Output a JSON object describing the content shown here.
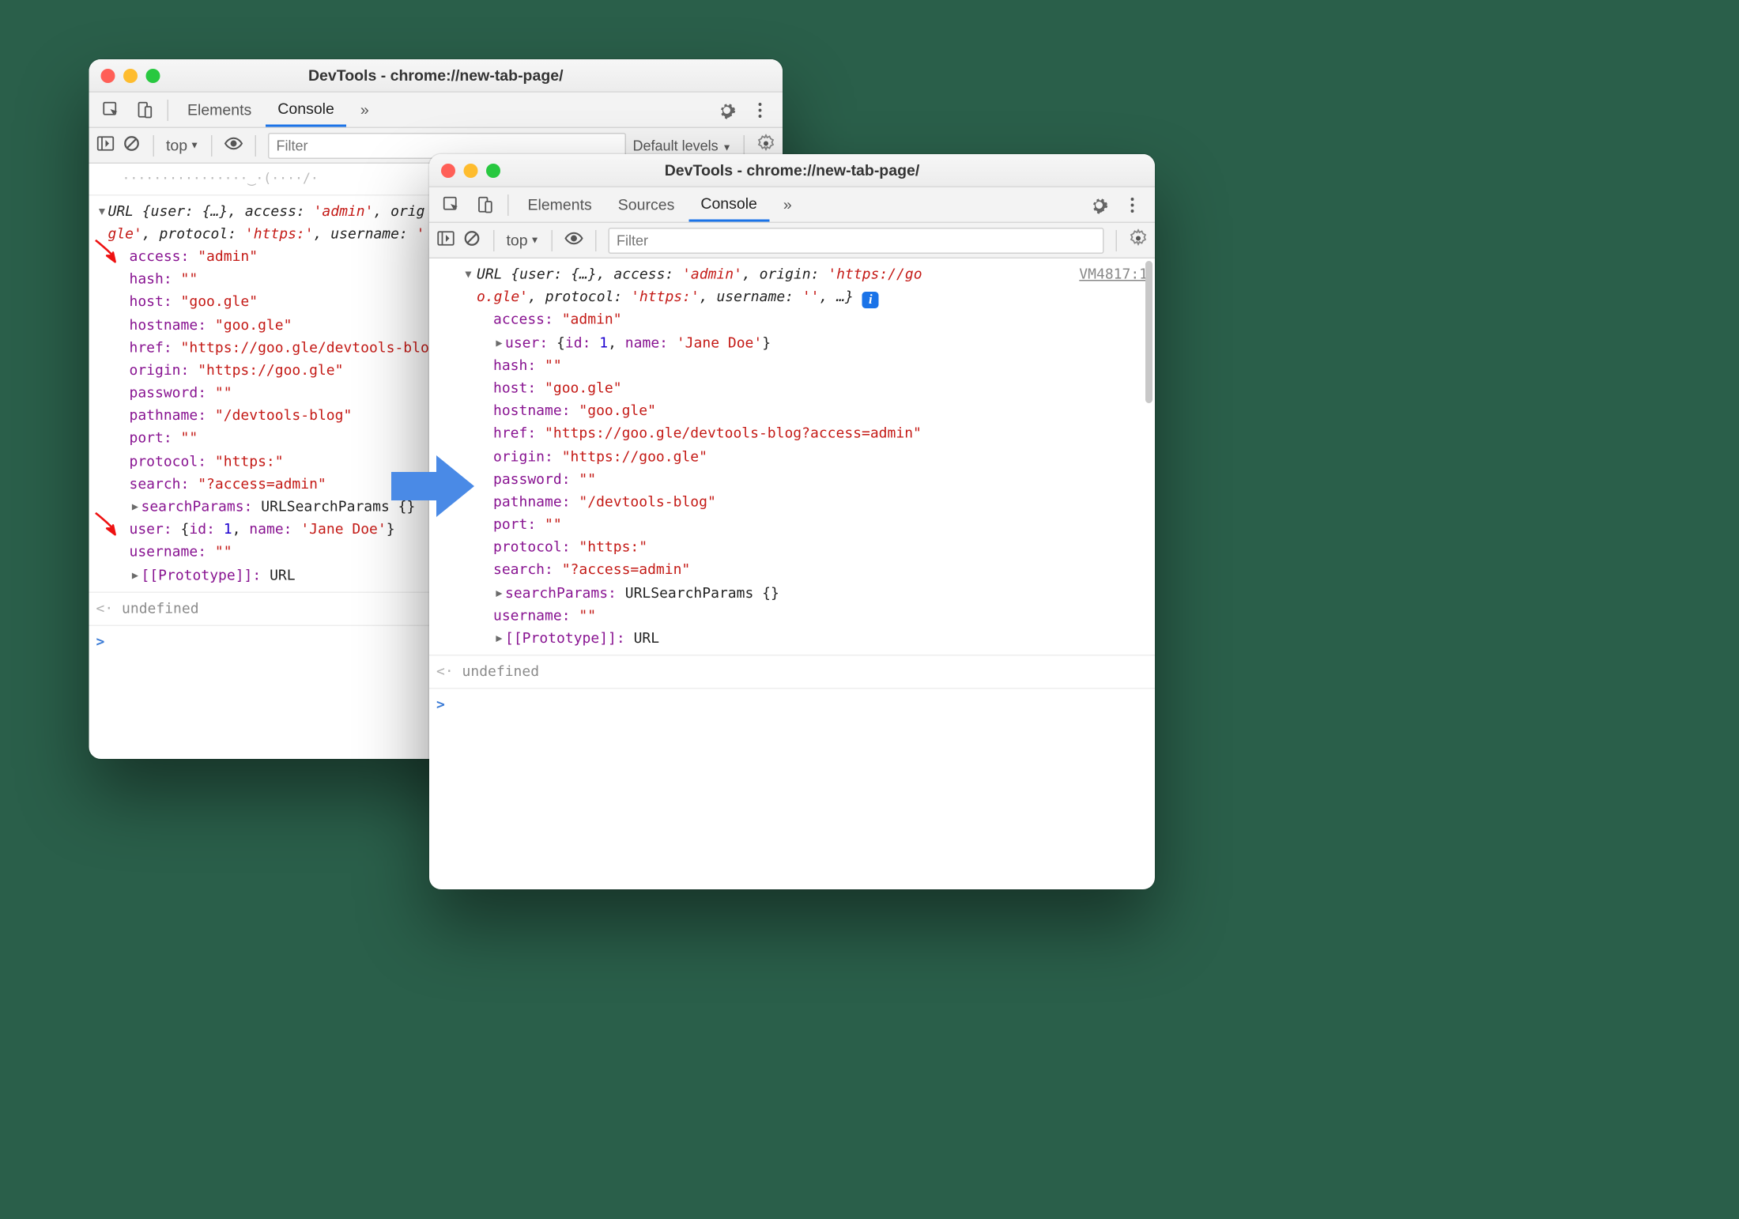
{
  "titleLeft": "DevTools - chrome://new-tab-page/",
  "titleRight": "DevTools - chrome://new-tab-page/",
  "tabsLeft": {
    "elements": "Elements",
    "console": "Console",
    "more": "»"
  },
  "tabsRight": {
    "elements": "Elements",
    "sources": "Sources",
    "console": "Console",
    "more": "»"
  },
  "ctx": "top",
  "filterPlaceholder": "Filter",
  "levels": "Default levels",
  "sourceLink": "VM4817:1",
  "undef": "undefined",
  "summaryL1a": "URL {user: {…}, access: ",
  "summaryL1b": ", orig",
  "summaryL2": "gle'",
  "summaryL2b": ", protocol: ",
  "summaryL2c": ", username: ",
  "sp_admin": "'admin'",
  "sp_https": "'https:'",
  "sp_emptyq": "'",
  "summaryR1a": "URL {user: {…}, access: ",
  "summaryR1b": ", origin: ",
  "summaryR1c": "'https://go",
  "summaryR2a": "o.gle'",
  "summaryR2b": ", protocol: ",
  "summaryR2c": ", username: ",
  "summaryR2d": "''",
  "summaryR2e": ", …}",
  "left": {
    "access_k": "access:",
    "access_v": "\"admin\"",
    "hash_k": "hash:",
    "hash_v": "\"\"",
    "host_k": "host:",
    "host_v": "\"goo.gle\"",
    "hostname_k": "hostname:",
    "hostname_v": "\"goo.gle\"",
    "href_k": "href:",
    "href_v": "\"https://goo.gle/devtools-blo",
    "origin_k": "origin:",
    "origin_v": "\"https://goo.gle\"",
    "password_k": "password:",
    "password_v": "\"\"",
    "pathname_k": "pathname:",
    "pathname_v": "\"/devtools-blog\"",
    "port_k": "port:",
    "port_v": "\"\"",
    "protocol_k": "protocol:",
    "protocol_v": "\"https:\"",
    "search_k": "search:",
    "search_v": "\"?access=admin\"",
    "sp_k": "searchParams:",
    "sp_v": "URLSearchParams {}",
    "user_k": "user:",
    "user_pre": "{",
    "user_idk": "id:",
    "user_idv": "1",
    "user_c": ", ",
    "user_nk": "name:",
    "user_nv": "'Jane Doe'",
    "user_post": "}",
    "username_k": "username:",
    "username_v": "\"\"",
    "proto_k": "[[Prototype]]:",
    "proto_v": "URL"
  },
  "right": {
    "access_k": "access:",
    "access_v": "\"admin\"",
    "user_k": "user:",
    "user_pre": "{",
    "user_idk": "id:",
    "user_idv": "1",
    "user_c": ", ",
    "user_nk": "name:",
    "user_nv": "'Jane Doe'",
    "user_post": "}",
    "hash_k": "hash:",
    "hash_v": "\"\"",
    "host_k": "host:",
    "host_v": "\"goo.gle\"",
    "hostname_k": "hostname:",
    "hostname_v": "\"goo.gle\"",
    "href_k": "href:",
    "href_v": "\"https://goo.gle/devtools-blog?access=admin\"",
    "origin_k": "origin:",
    "origin_v": "\"https://goo.gle\"",
    "password_k": "password:",
    "password_v": "\"\"",
    "pathname_k": "pathname:",
    "pathname_v": "\"/devtools-blog\"",
    "port_k": "port:",
    "port_v": "\"\"",
    "protocol_k": "protocol:",
    "protocol_v": "\"https:\"",
    "search_k": "search:",
    "search_v": "\"?access=admin\"",
    "sp_k": "searchParams:",
    "sp_v": "URLSearchParams {}",
    "username_k": "username:",
    "username_v": "\"\"",
    "proto_k": "[[Prototype]]:",
    "proto_v": "URL"
  }
}
